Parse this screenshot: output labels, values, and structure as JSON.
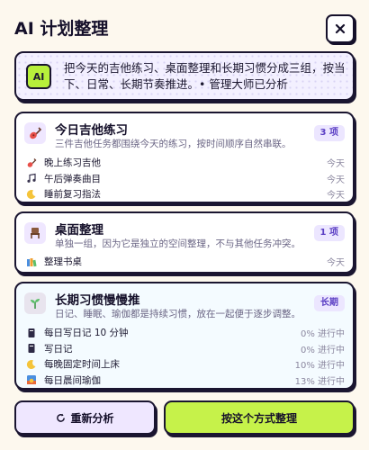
{
  "header": {
    "title": "AI 计划整理",
    "close_label": "×"
  },
  "intro": {
    "badge": "AI",
    "text": "把今天的吉他练习、桌面整理和长期习惯分成三组，按当下、日常、长期节奏推进。• 管理大师已分析"
  },
  "sections": [
    {
      "title": "今日吉他练习",
      "subtitle": "三件吉他任务都围绕今天的练习，按时间顺序自然串联。",
      "badge": "3 项",
      "icon": "guitar-icon",
      "items": [
        {
          "label": "晚上练习吉他",
          "meta": "今天",
          "icon": "guitar-icon"
        },
        {
          "label": "午后弹奏曲目",
          "meta": "今天",
          "icon": "music-note-icon"
        },
        {
          "label": "睡前复习指法",
          "meta": "今天",
          "icon": "moon-icon"
        }
      ]
    },
    {
      "title": "桌面整理",
      "subtitle": "单独一组，因为它是独立的空间整理，不与其他任务冲突。",
      "badge": "1 项",
      "icon": "chair-icon",
      "items": [
        {
          "label": "整理书桌",
          "meta": "今天",
          "icon": "books-icon"
        }
      ]
    },
    {
      "title": "长期习惯慢慢推",
      "subtitle": "日记、睡眠、瑜伽都是持续习惯，放在一起便于逐步调整。",
      "badge": "长期",
      "icon": "sprout-icon",
      "items": [
        {
          "label": "每日写日记 10 分钟",
          "meta": "0% 进行中",
          "progress": 0,
          "icon": "notebook-icon"
        },
        {
          "label": "写日记",
          "meta": "0% 进行中",
          "progress": 0,
          "icon": "notebook-icon"
        },
        {
          "label": "每晚固定时间上床",
          "meta": "10% 进行中",
          "progress": 10,
          "icon": "moon-icon"
        },
        {
          "label": "每日晨间瑜伽",
          "meta": "13% 进行中",
          "progress": 13,
          "icon": "sunrise-icon"
        }
      ]
    }
  ],
  "buttons": {
    "reanalyze": "重新分析",
    "confirm": "按这个方式整理"
  },
  "colors": {
    "accent_green": "#c6f24a",
    "accent_purple": "#5b3fc4",
    "background": "#fdf8ee"
  }
}
